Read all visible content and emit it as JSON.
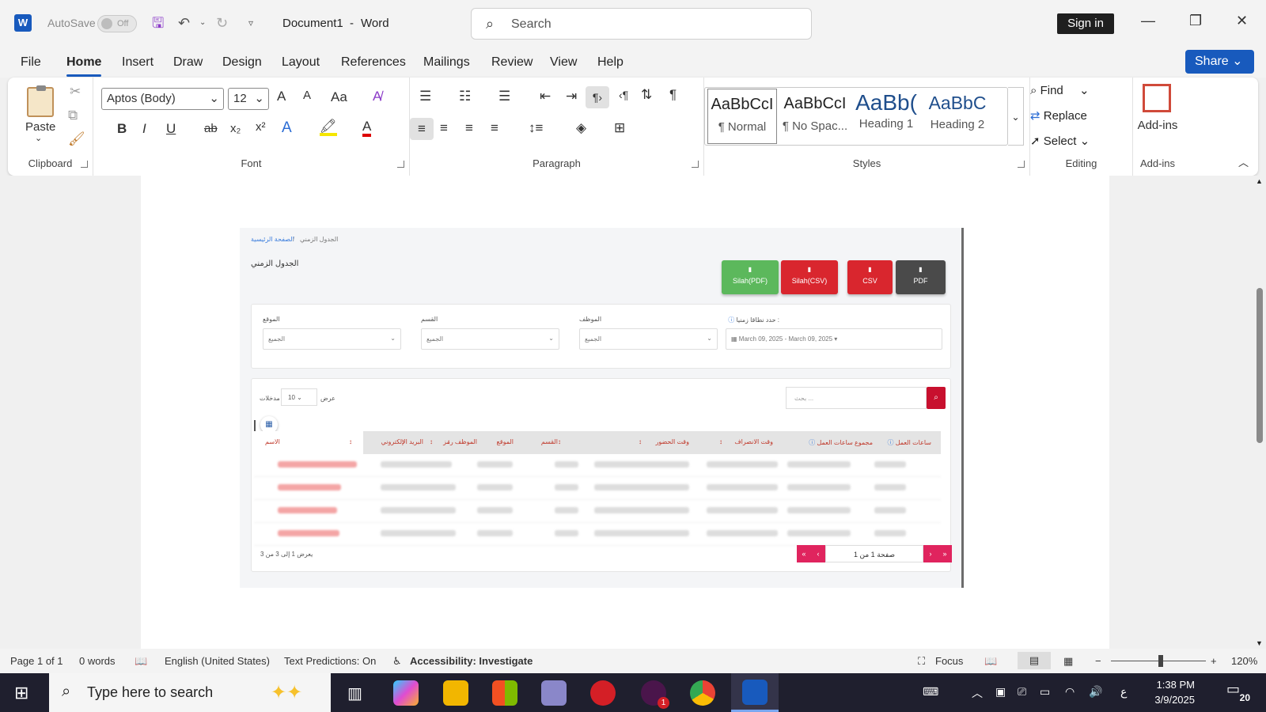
{
  "titlebar": {
    "app_icon_letter": "W",
    "autosave_label": "AutoSave",
    "autosave_state": "Off",
    "document_title": "Document1",
    "separator": "-",
    "app_name": "Word",
    "search_placeholder": "Search",
    "sign_in": "Sign in"
  },
  "menu": {
    "items": [
      "File",
      "Home",
      "Insert",
      "Draw",
      "Design",
      "Layout",
      "References",
      "Mailings",
      "Review",
      "View",
      "Help"
    ],
    "active": "Home",
    "share": "Share"
  },
  "ribbon": {
    "clipboard": {
      "paste": "Paste",
      "label": "Clipboard"
    },
    "font": {
      "name": "Aptos (Body)",
      "size": "12",
      "grow": "A",
      "shrink": "A",
      "case": "Aa",
      "bold": "B",
      "italic": "I",
      "underline": "U",
      "strike": "ab",
      "sub": "x₂",
      "sup": "x²",
      "label": "Font"
    },
    "paragraph": {
      "label": "Paragraph"
    },
    "styles": {
      "items": [
        {
          "preview": "AaBbCcI",
          "name": "¶ Normal"
        },
        {
          "preview": "AaBbCcI",
          "name": "¶ No Spac..."
        },
        {
          "preview": "AaBb(",
          "name": "Heading 1"
        },
        {
          "preview": "AaBbC",
          "name": "Heading 2"
        }
      ],
      "label": "Styles"
    },
    "editing": {
      "find": "Find",
      "replace": "Replace",
      "select": "Select",
      "label": "Editing"
    },
    "addins": {
      "button": "Add-ins",
      "label": "Add-ins"
    }
  },
  "embedded": {
    "breadcrumb_home": "الصفحة الرئيسية",
    "breadcrumb_sep": "/",
    "breadcrumb_current": "الجدول الزمني",
    "page_title": "الجدول الزمني",
    "buttons": [
      {
        "label": "Silah(PDF)",
        "color": "#5cb85c"
      },
      {
        "label": "Silah(CSV)",
        "color": "#d9262e"
      },
      {
        "label": "CSV",
        "color": "#d9262e"
      },
      {
        "label": "PDF",
        "color": "#4a4a4a"
      }
    ],
    "filters": {
      "date_label": "حدد نطاقا زمنيا :",
      "date_value": "March 09, 2025 - March 09, 2025",
      "employee_label": "الموظف",
      "department_label": "القسم",
      "location_label": "الموقع",
      "all": "الجميع"
    },
    "table_tools": {
      "search_placeholder": "بحث ...",
      "show_label": "عرض",
      "page_size": "10",
      "entries_label": "مدخلات"
    },
    "columns": [
      "ساعات العمل",
      "مجموع ساعات العمل",
      "وقت الانصراف",
      "وقت الحضور",
      "القسم",
      "الموقع",
      "الموظف رمز",
      "البريد الإلكتروني",
      "الاسم"
    ],
    "footer": {
      "showing": "يعرض 1 إلى 3 من 3",
      "page_info": "صفحة 1 من 1",
      "first": "«",
      "prev": "‹",
      "next": "›",
      "last": "»"
    }
  },
  "statusbar": {
    "page": "Page 1 of 1",
    "words": "0 words",
    "language": "English (United States)",
    "predictions": "Text Predictions: On",
    "accessibility": "Accessibility: Investigate",
    "focus": "Focus",
    "zoom": "120%"
  },
  "taskbar": {
    "search_placeholder": "Type here to search",
    "ime": "ع",
    "time": "1:38 PM",
    "date": "3/9/2025",
    "notifications": "20",
    "badge": "1"
  }
}
